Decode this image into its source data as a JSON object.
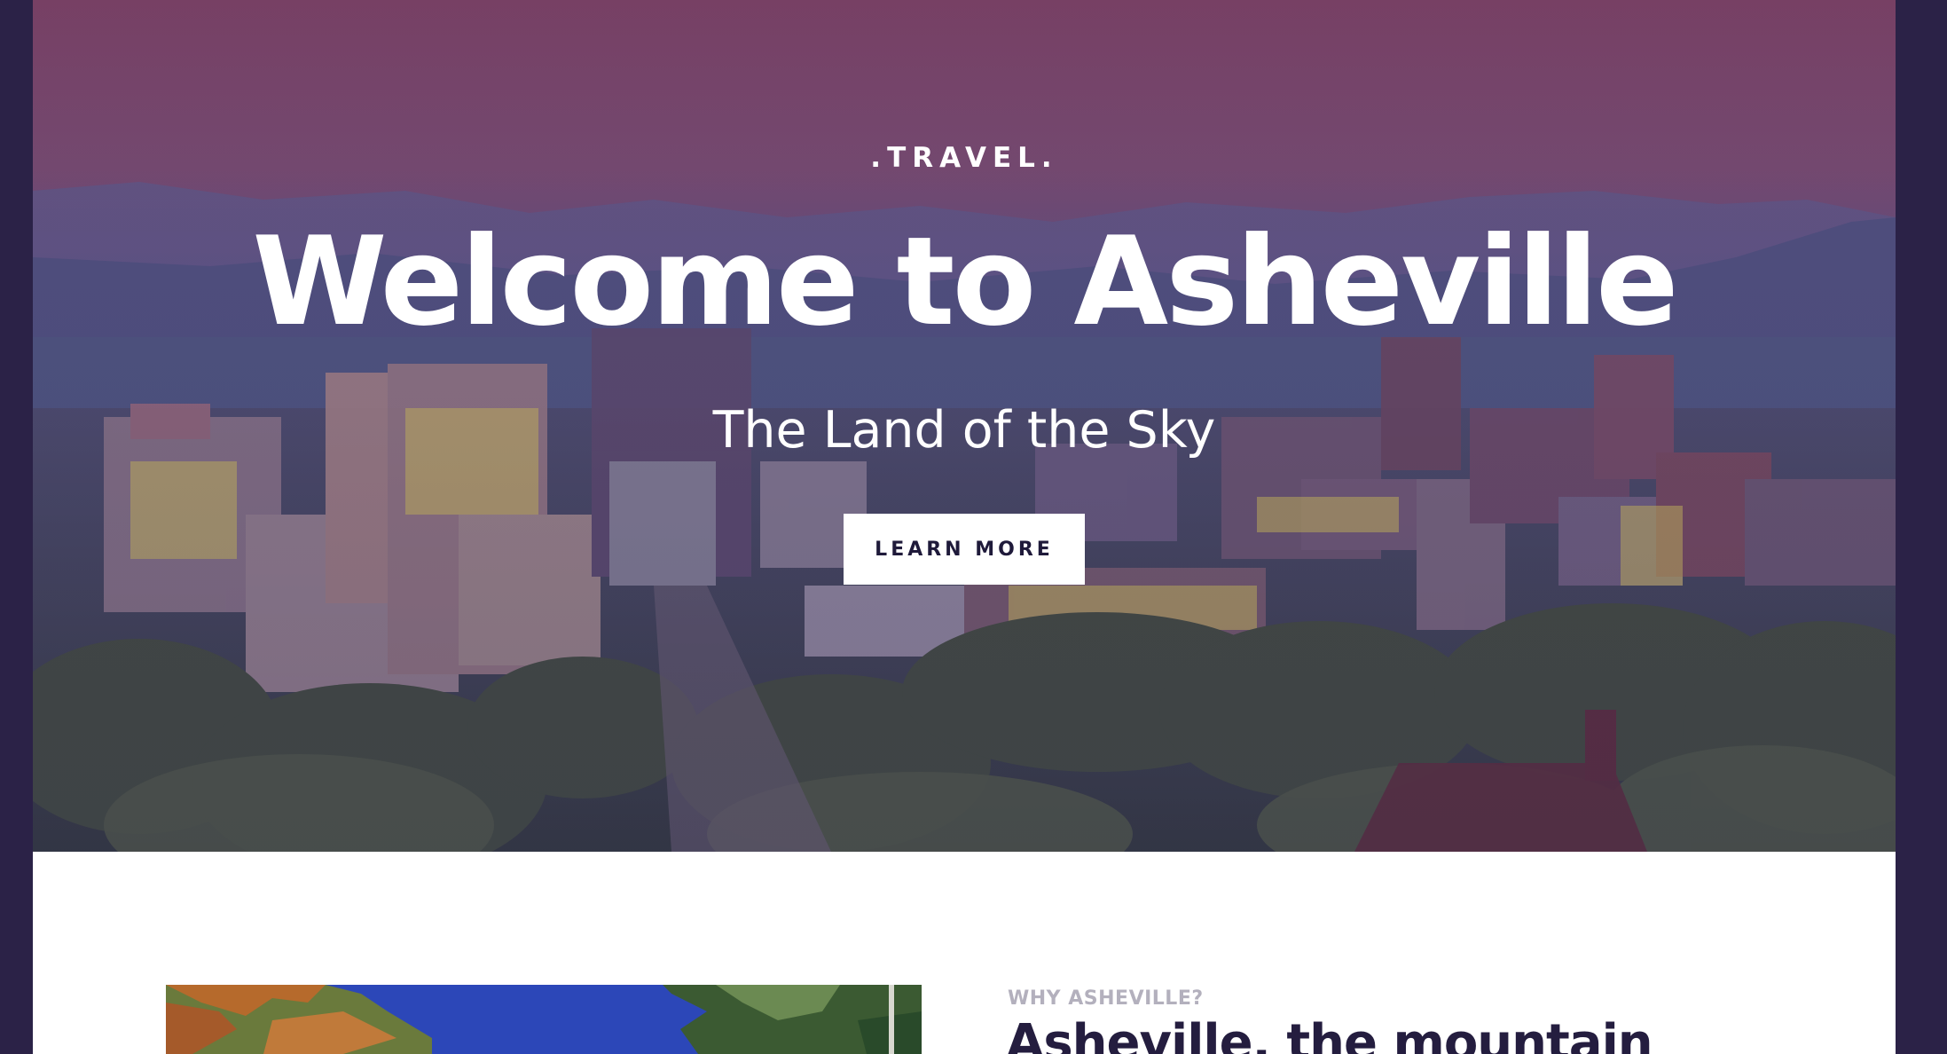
{
  "hero": {
    "eyebrow": ".TRAVEL.",
    "title": "Welcome to Asheville",
    "subtitle": "The Land of the Sky",
    "button_label": "LEARN MORE",
    "background_image": "asheville-skyline-photo"
  },
  "why": {
    "label": "WHY ASHEVILLE?",
    "heading": "Asheville, the mountain",
    "image": "autumn-forest-photo"
  },
  "colors": {
    "frame": "#2b2247",
    "page": "#ffffff",
    "button_bg": "#ffffff",
    "button_text": "#1f1a3a",
    "heading_dark": "#241d3f",
    "label_gray": "#b3b0bd"
  }
}
